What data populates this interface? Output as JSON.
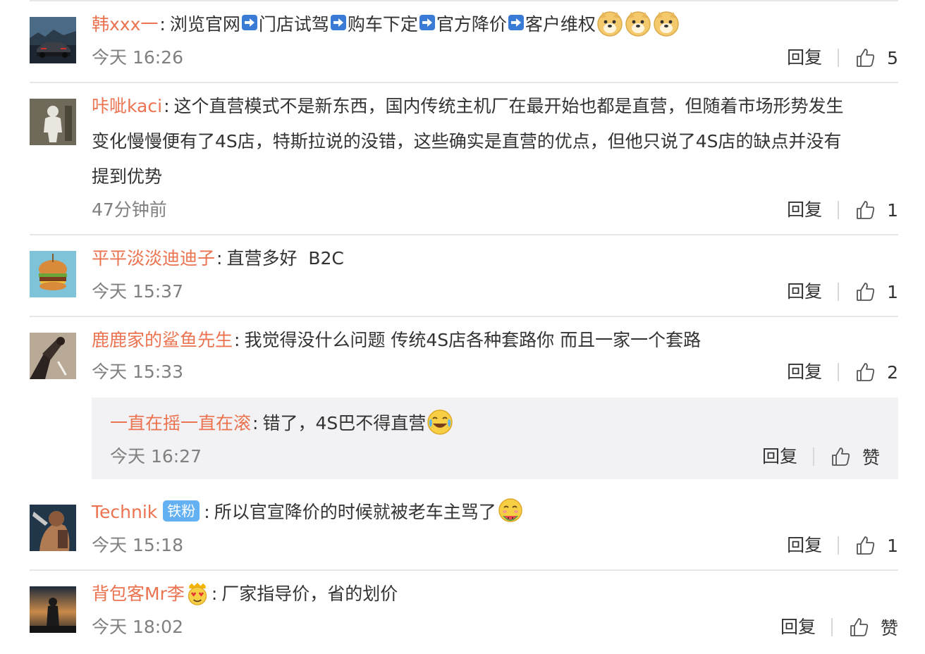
{
  "colors": {
    "username": "#eb7350",
    "text": "#333333",
    "time": "#808080",
    "badge": "#63b0f3",
    "subreply_bg": "#f2f2f5"
  },
  "comments": [
    {
      "username": "韩xxx一",
      "segments": [
        "浏览官网",
        "门店试驾",
        "购车下定",
        "官方降价",
        "客户维权"
      ],
      "emoji": [
        "doge-emoji",
        "doge-emoji",
        "doge-emoji"
      ],
      "time": "今天 16:26",
      "reply": "回复",
      "likes": "5"
    },
    {
      "username": "咔呲kaci",
      "line1": "这个直营模式不是新东西，国内传统主机厂在最开始也都是直营，但随着市场形势发生",
      "line2": "变化慢慢便有了4S店，特斯拉说的没错，这些确实是直营的优点，但他只说了4S店的缺点并没有",
      "line3": "提到优势",
      "time": "47分钟前",
      "reply": "回复",
      "likes": "1"
    },
    {
      "username": "平平淡淡迪迪子",
      "text": "直营多好  B2C",
      "time": "今天 15:37",
      "reply": "回复",
      "likes": "1"
    },
    {
      "username": "鹿鹿家的鲨鱼先生",
      "text": "我觉得没什么问题 传统4S店各种套路你 而且一家一个套路",
      "time": "今天 15:33",
      "reply": "回复",
      "likes": "2",
      "sub_reply": {
        "username": "一直在摇一直在滚",
        "text": "错了，4S巴不得直营",
        "emoji": "laugh-cry-emoji",
        "time": "今天 16:27",
        "reply": "回复",
        "like_label": "赞"
      }
    },
    {
      "username": "Technik",
      "badge": "铁粉",
      "text": "所以官宣降价的时候就被老车主骂了",
      "emoji": "eating-watermelon-emoji",
      "time": "今天 15:18",
      "reply": "回复",
      "likes": "1"
    },
    {
      "username": "背包客Mr李",
      "user_emoji": "love-eyes-emoji",
      "text": "厂家指导价，省的划价",
      "time": "今天 18:02",
      "reply": "回复",
      "like_label": "赞"
    }
  ]
}
